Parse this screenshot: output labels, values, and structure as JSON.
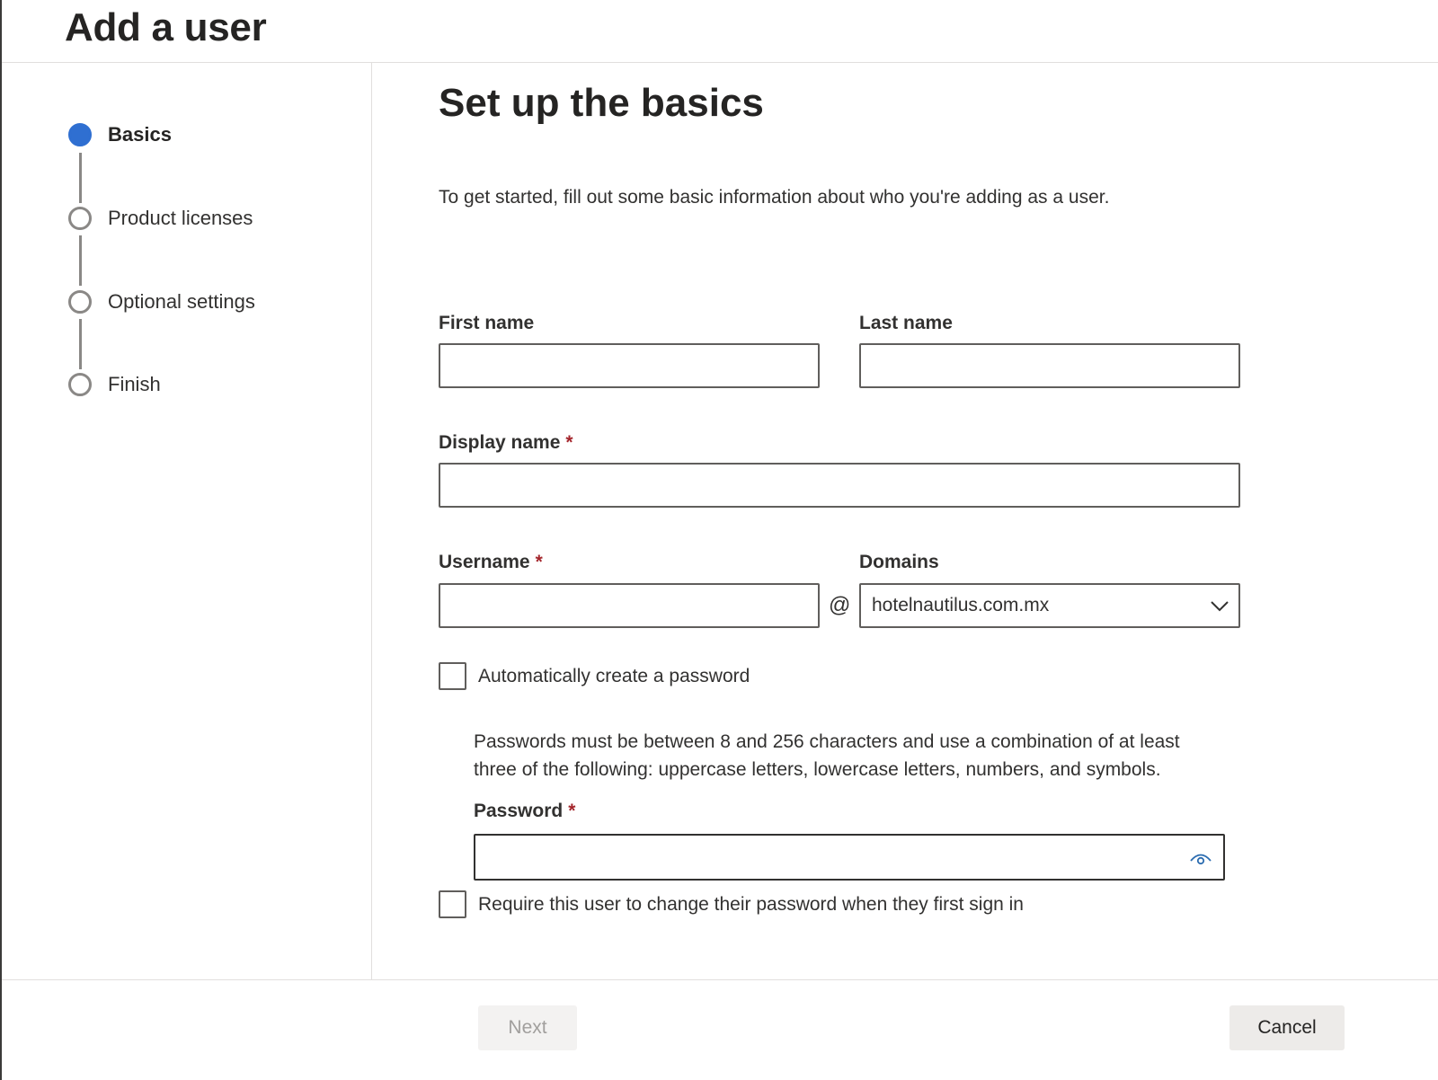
{
  "header": {
    "title": "Add a user"
  },
  "wizard": {
    "steps": [
      {
        "label": "Basics",
        "state": "current"
      },
      {
        "label": "Product licenses",
        "state": "pending"
      },
      {
        "label": "Optional settings",
        "state": "pending"
      },
      {
        "label": "Finish",
        "state": "pending"
      }
    ]
  },
  "form": {
    "title": "Set up the basics",
    "intro": "To get started, fill out some basic information about who you're adding as a user.",
    "first_name": {
      "label": "First name",
      "value": ""
    },
    "last_name": {
      "label": "Last name",
      "value": ""
    },
    "display_name": {
      "label": "Display name",
      "required_mark": "*",
      "value": ""
    },
    "username": {
      "label": "Username",
      "required_mark": "*",
      "value": ""
    },
    "at_sign": "@",
    "domains": {
      "label": "Domains",
      "selected": "hotelnautilus.com.mx"
    },
    "auto_password": {
      "label": "Automatically create a password",
      "checked": false
    },
    "password_hint": "Passwords must be between 8 and 256 characters and use a combination of at least three of the following: uppercase letters, lowercase letters, numbers, and symbols.",
    "password": {
      "label": "Password",
      "required_mark": "*",
      "value": "",
      "icon": "eye-icon"
    },
    "require_change": {
      "label": "Require this user to change their password when they first sign in",
      "checked": false
    }
  },
  "footer": {
    "next_label": "Next",
    "cancel_label": "Cancel"
  },
  "colors": {
    "accent": "#2f6fd1",
    "required": "#a4262c",
    "border": "#605e5c"
  }
}
